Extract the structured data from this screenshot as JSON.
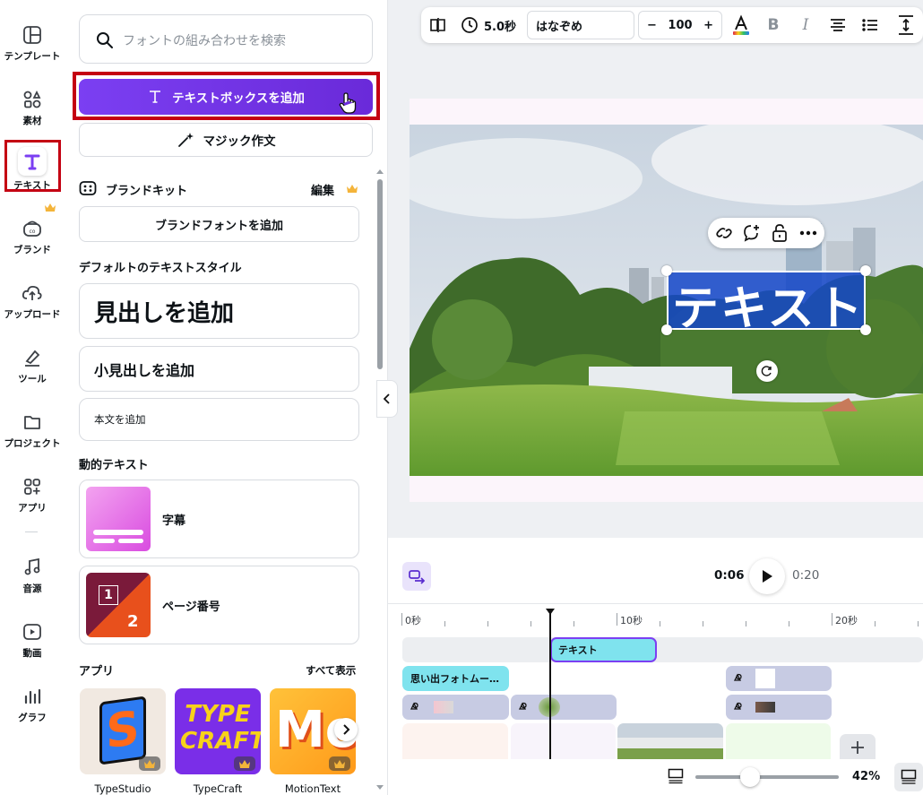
{
  "rail": {
    "items": [
      {
        "label": "テンプレート",
        "icon": "template-icon"
      },
      {
        "label": "素材",
        "icon": "elements-icon"
      },
      {
        "label": "テキスト",
        "icon": "text-icon",
        "active": true
      },
      {
        "label": "ブランド",
        "icon": "brand-icon"
      },
      {
        "label": "アップロード",
        "icon": "upload-icon"
      },
      {
        "label": "ツール",
        "icon": "tools-icon"
      },
      {
        "label": "プロジェクト",
        "icon": "folder-icon"
      },
      {
        "label": "アプリ",
        "icon": "apps-icon"
      },
      {
        "label": "音源",
        "icon": "music-icon"
      },
      {
        "label": "動画",
        "icon": "video-icon"
      },
      {
        "label": "グラフ",
        "icon": "chart-icon"
      }
    ]
  },
  "panel": {
    "search_placeholder": "フォントの組み合わせを検索",
    "add_textbox": "テキストボックスを追加",
    "magic_write": "マジック作文",
    "brand_kit": "ブランドキット",
    "brand_edit": "編集",
    "brand_font": "ブランドフォントを追加",
    "default_styles": "デフォルトのテキストスタイル",
    "heading": "見出しを追加",
    "subheading": "小見出しを追加",
    "body": "本文を追加",
    "dynamic_text": "動的テキスト",
    "subtitles": "字幕",
    "page_number": "ページ番号",
    "page_number_digits": [
      "1",
      "2"
    ],
    "apps_title": "アプリ",
    "apps_show_all": "すべて表示",
    "apps": [
      {
        "name": "TypeStudio",
        "thumb_text": "S"
      },
      {
        "name": "TypeCraft",
        "thumb_text_1": "TYPE",
        "thumb_text_2": "CRAFT"
      },
      {
        "name": "MotionText",
        "thumb_text": "Mo"
      }
    ]
  },
  "toolbar": {
    "duration": "5.0秒",
    "font": "はなぞめ",
    "font_size": "100",
    "minus": "−",
    "plus": "+",
    "bold": "B",
    "italic": "I",
    "text_color": "#e0224a"
  },
  "canvas": {
    "text": "テキスト"
  },
  "playback": {
    "current": "0:06",
    "total": "0:20"
  },
  "timeline": {
    "ticks": [
      "0秒",
      "10秒",
      "20秒"
    ],
    "text_clip": "テキスト",
    "clip_photo_movie": "思い出フォトムー…"
  },
  "footer": {
    "zoom": "42%",
    "zoom_fraction": 0.38
  },
  "colors": {
    "accent": "#7b3ff2",
    "highlight": "#c40012",
    "text_clip": "#7fe3ee"
  }
}
